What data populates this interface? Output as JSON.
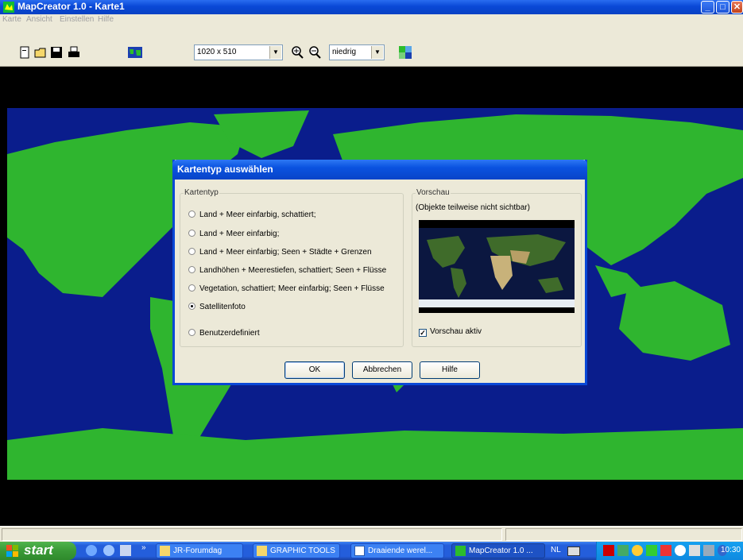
{
  "window": {
    "title": "MapCreator 1.0 - Karte1",
    "min": "_",
    "max": "□",
    "close": "✕"
  },
  "menu": {
    "items": [
      "Karte",
      "Ansicht",
      "Einstellen",
      "Hilfe"
    ]
  },
  "toolbar": {
    "size_value": "1020 x 510",
    "quality_value": "niedrig"
  },
  "dialog": {
    "title": "Kartentyp auswählen",
    "type_group": "Kartentyp",
    "options": [
      "Land + Meer einfarbig, schattiert;",
      "Land + Meer einfarbig;",
      "Land + Meer einfarbig; Seen + Städte + Grenzen",
      "Landhöhen + Meerestiefen, schattiert; Seen + Flüsse",
      "Vegetation, schattiert; Meer einfarbig; Seen + Flüsse",
      "Satellitenfoto",
      "Benutzerdefiniert"
    ],
    "selected_index": 5,
    "preview_group": "Vorschau",
    "preview_note": "(Objekte teilweise nicht sichtbar)",
    "preview_checkbox": "Vorschau aktiv",
    "preview_checked": true,
    "ok": "OK",
    "cancel": "Abbrechen",
    "help": "Hilfe"
  },
  "taskbar": {
    "start": "start",
    "tasks": [
      "JR-Forumdag",
      "GRAPHIC TOOLS",
      "Draaiende werel...",
      "MapCreator 1.0 ..."
    ],
    "active_task": 3,
    "language": "NL",
    "clock": "10:30"
  },
  "colors": {
    "ocean": "#0a1d8c",
    "land": "#2fb52f",
    "titlebar": "#0a48d6",
    "accent": "#245edb"
  }
}
